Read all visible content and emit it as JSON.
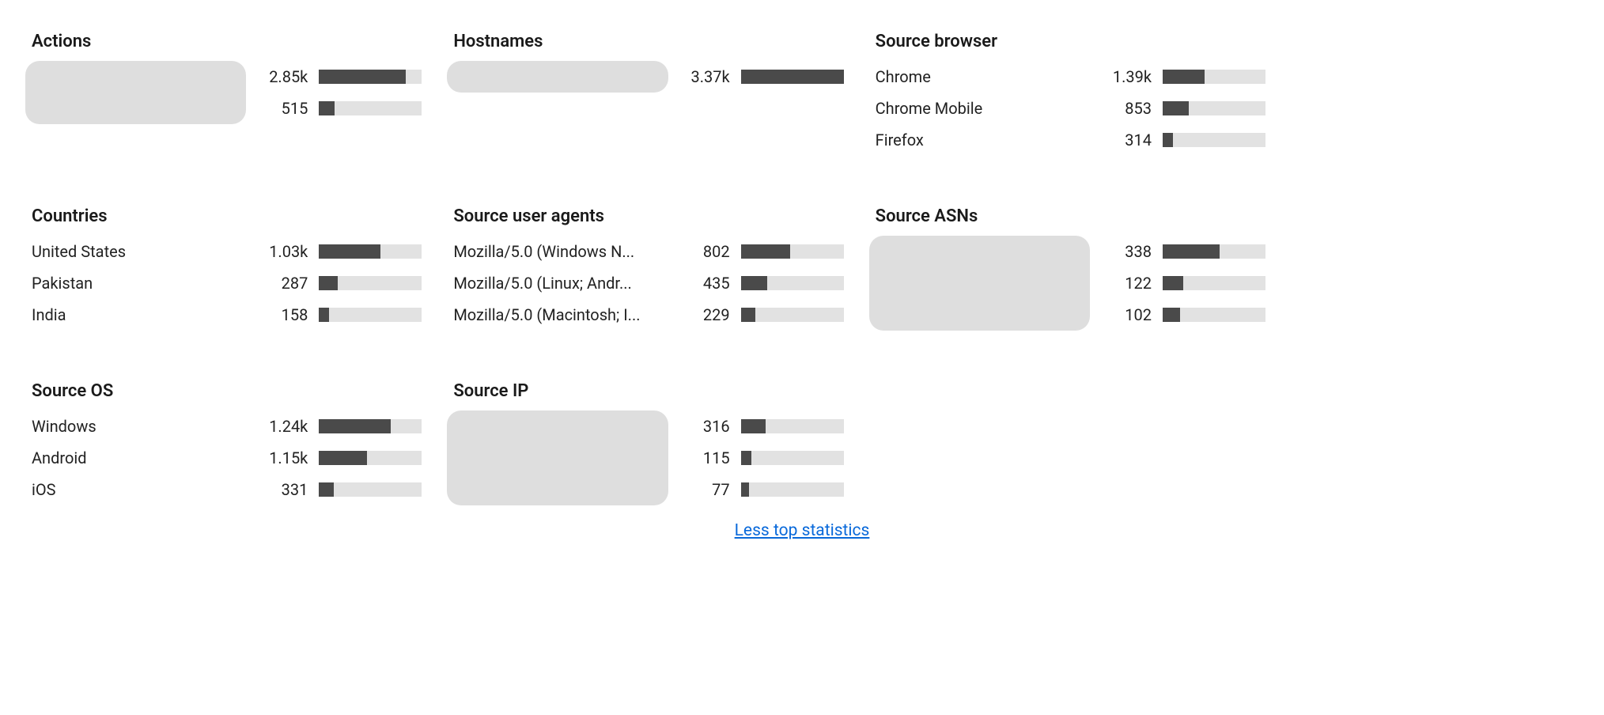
{
  "chart_data": [
    {
      "type": "bar",
      "title": "Actions",
      "labels_redacted": true,
      "series": [
        {
          "label": "",
          "value": 2850,
          "display": "2.85k",
          "fill_pct": 84
        },
        {
          "label": "",
          "value": 515,
          "display": "515",
          "fill_pct": 15
        }
      ]
    },
    {
      "type": "bar",
      "title": "Hostnames",
      "labels_redacted": true,
      "series": [
        {
          "label": "",
          "value": 3370,
          "display": "3.37k",
          "fill_pct": 100
        }
      ]
    },
    {
      "type": "bar",
      "title": "Source browser",
      "labels_redacted": false,
      "series": [
        {
          "label": "Chrome",
          "value": 1390,
          "display": "1.39k",
          "fill_pct": 41
        },
        {
          "label": "Chrome Mobile",
          "value": 853,
          "display": "853",
          "fill_pct": 25
        },
        {
          "label": "Firefox",
          "value": 314,
          "display": "314",
          "fill_pct": 10
        }
      ]
    },
    {
      "type": "bar",
      "title": "Countries",
      "labels_redacted": false,
      "series": [
        {
          "label": "United States",
          "value": 1030,
          "display": "1.03k",
          "fill_pct": 60
        },
        {
          "label": "Pakistan",
          "value": 287,
          "display": "287",
          "fill_pct": 18
        },
        {
          "label": "India",
          "value": 158,
          "display": "158",
          "fill_pct": 10
        }
      ]
    },
    {
      "type": "bar",
      "title": "Source user agents",
      "labels_redacted": false,
      "series": [
        {
          "label": "Mozilla/5.0 (Windows N...",
          "value": 802,
          "display": "802",
          "fill_pct": 48
        },
        {
          "label": "Mozilla/5.0 (Linux; Andr...",
          "value": 435,
          "display": "435",
          "fill_pct": 26
        },
        {
          "label": "Mozilla/5.0 (Macintosh; I...",
          "value": 229,
          "display": "229",
          "fill_pct": 14
        }
      ]
    },
    {
      "type": "bar",
      "title": "Source ASNs",
      "labels_redacted": true,
      "series": [
        {
          "label": "",
          "value": 338,
          "display": "338",
          "fill_pct": 55
        },
        {
          "label": "",
          "value": 122,
          "display": "122",
          "fill_pct": 20
        },
        {
          "label": "",
          "value": 102,
          "display": "102",
          "fill_pct": 17
        }
      ]
    },
    {
      "type": "bar",
      "title": "Source OS",
      "labels_redacted": false,
      "series": [
        {
          "label": "Windows",
          "value": 1240,
          "display": "1.24k",
          "fill_pct": 70
        },
        {
          "label": "Android",
          "value": 1150,
          "display": "1.15k",
          "fill_pct": 47
        },
        {
          "label": "iOS",
          "value": 331,
          "display": "331",
          "fill_pct": 14
        }
      ]
    },
    {
      "type": "bar",
      "title": "Source IP",
      "labels_redacted": true,
      "series": [
        {
          "label": "",
          "value": 316,
          "display": "316",
          "fill_pct": 24
        },
        {
          "label": "",
          "value": 115,
          "display": "115",
          "fill_pct": 10
        },
        {
          "label": "",
          "value": 77,
          "display": "77",
          "fill_pct": 8
        }
      ]
    }
  ],
  "footer": {
    "less_link": "Less top statistics"
  }
}
